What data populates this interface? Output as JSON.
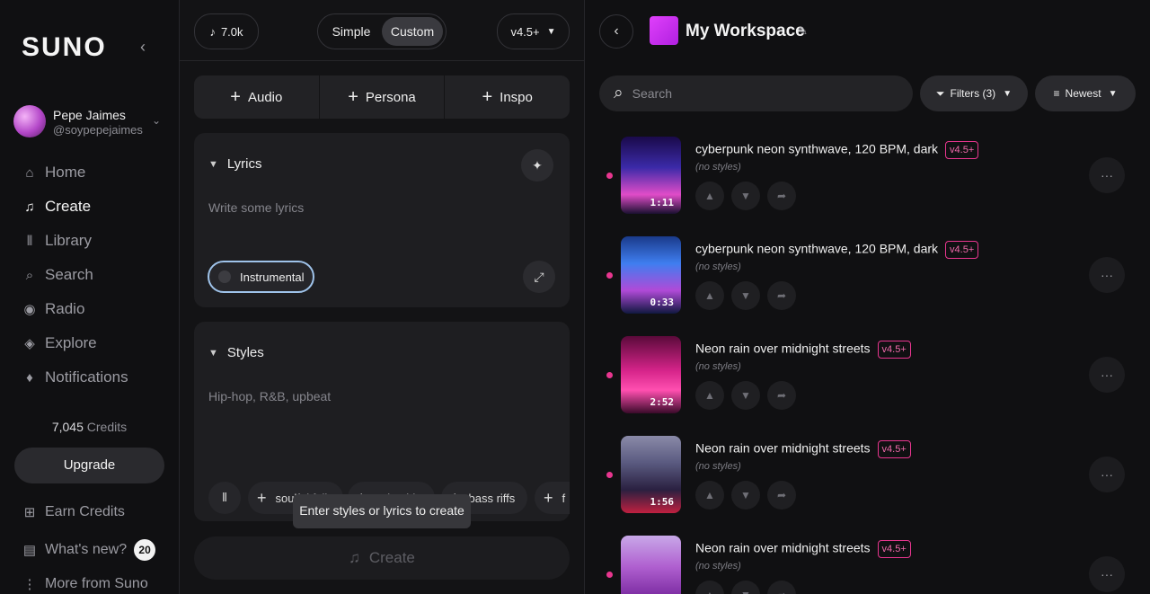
{
  "sidebar": {
    "logo": "SUNO",
    "user": {
      "name": "Pepe Jaimes",
      "handle": "@soypepejaimes"
    },
    "nav": [
      {
        "label": "Home",
        "icon": "home-icon"
      },
      {
        "label": "Create",
        "icon": "create-icon"
      },
      {
        "label": "Library",
        "icon": "library-icon"
      },
      {
        "label": "Search",
        "icon": "search-icon"
      },
      {
        "label": "Radio",
        "icon": "radio-icon"
      },
      {
        "label": "Explore",
        "icon": "explore-icon"
      },
      {
        "label": "Notifications",
        "icon": "bell-icon"
      }
    ],
    "credits_value": "7,045",
    "credits_label": "Credits",
    "upgrade": "Upgrade",
    "earn_credits": "Earn Credits",
    "whats_new": "What's new?",
    "whats_new_count": "20",
    "more_from": "More from Suno"
  },
  "create": {
    "note_count": "7.0k",
    "mode_simple": "Simple",
    "mode_custom": "Custom",
    "model": "v4.5+",
    "tools": [
      "Audio",
      "Persona",
      "Inspo"
    ],
    "lyrics_title": "Lyrics",
    "lyrics_placeholder": "Write some lyrics",
    "instrumental": "Instrumental",
    "styles_title": "Styles",
    "styles_placeholder": "Hip-hop, R&B, upbeat",
    "style_chips": [
      "soulful folk",
      "colombia",
      "bass riffs",
      "f"
    ],
    "tooltip": "Enter styles or lyrics to create",
    "create_button": "Create"
  },
  "workspace": {
    "title": "My Workspace",
    "search_placeholder": "Search",
    "filters": "Filters (3)",
    "sort": "Newest",
    "songs": [
      {
        "title": "cyberpunk neon synthwave, 120 BPM, dark",
        "version": "v4.5+",
        "styles": "(no styles)",
        "duration": "1:11"
      },
      {
        "title": "cyberpunk neon synthwave, 120 BPM, dark",
        "version": "v4.5+",
        "styles": "(no styles)",
        "duration": "0:33"
      },
      {
        "title": "Neon rain over midnight streets",
        "version": "v4.5+",
        "styles": "(no styles)",
        "duration": "2:52"
      },
      {
        "title": "Neon rain over midnight streets",
        "version": "v4.5+",
        "styles": "(no styles)",
        "duration": "1:56"
      },
      {
        "title": "Neon rain over midnight streets",
        "version": "v4.5+",
        "styles": "(no styles)",
        "duration": ""
      }
    ]
  },
  "colors": {
    "accent": "#e8368f",
    "background": "#101012",
    "panel": "#1e1e21"
  }
}
